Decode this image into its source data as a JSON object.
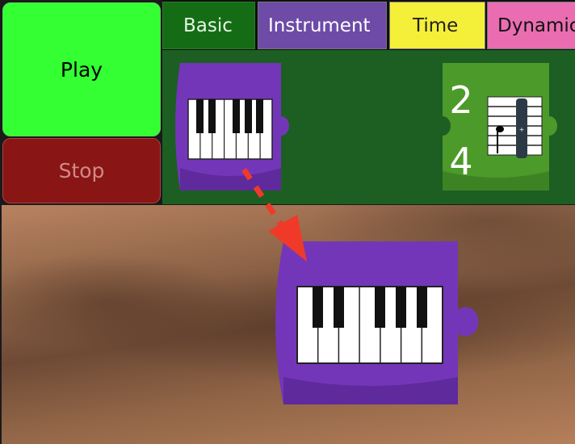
{
  "controls": {
    "play_label": "Play",
    "stop_label": "Stop"
  },
  "tabs": [
    {
      "label": "Basic",
      "color": "#146d14"
    },
    {
      "label": "Instrument",
      "color": "#6d4ba6"
    },
    {
      "label": "Time",
      "color": "#f4ef39"
    },
    {
      "label": "Dynamics",
      "color": "#ea6db1"
    }
  ],
  "palette": {
    "blocks": [
      {
        "kind": "instrument",
        "icon": "piano-keyboard-icon",
        "color": "#7436b9"
      },
      {
        "kind": "time-signature",
        "icon": "time-signature-icon",
        "numerator": "2",
        "denominator": "4",
        "color": "#4c9a2a"
      }
    ]
  },
  "workspace": {
    "blocks": [
      {
        "kind": "instrument",
        "icon": "piano-keyboard-icon",
        "color": "#7436b9"
      }
    ],
    "hint": {
      "icon": "drag-arrow-icon",
      "color": "#ef3a2a"
    }
  }
}
